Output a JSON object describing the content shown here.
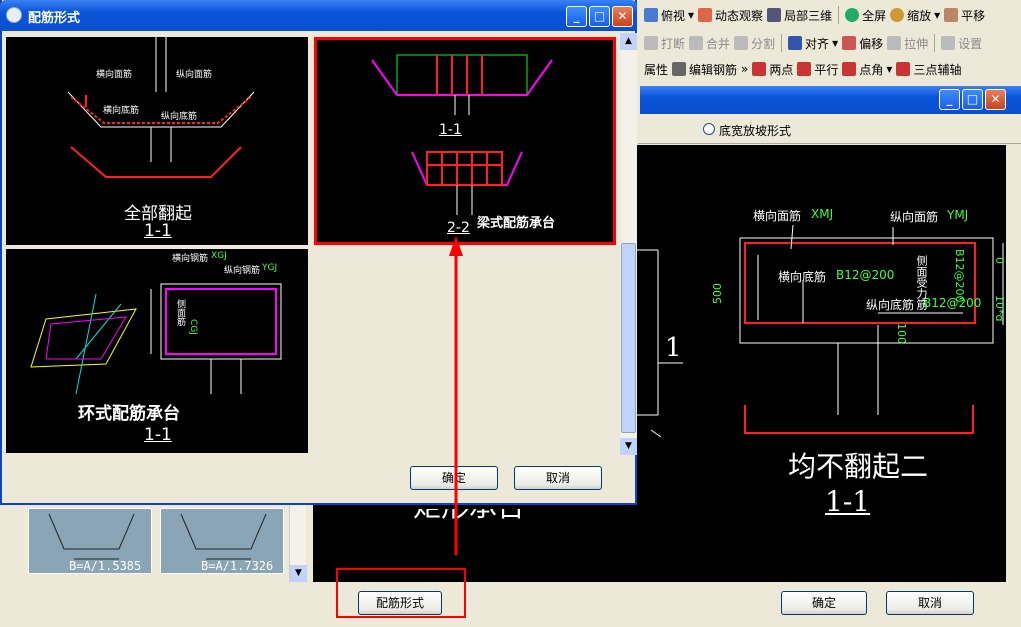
{
  "toolbar": {
    "row1": {
      "view": "俯视",
      "orbit": "动态观察",
      "local3d": "局部三维",
      "fullscreen": "全屏",
      "zoom": "缩放",
      "pan": "平移"
    },
    "row2": {
      "break": "打断",
      "merge": "合并",
      "split": "分割",
      "align": "对齐",
      "offset": "偏移",
      "stretch": "拉伸",
      "settings": "设置"
    },
    "row3": {
      "properties": "属性",
      "edit_rebar": "编辑钢筋",
      "two_point": "两点",
      "parallel": "平行",
      "point_angle": "点角",
      "three_point_axis": "三点辅轴"
    }
  },
  "bg_dialog": {
    "radio_label": "底宽放坡形式",
    "ok": "确定",
    "cancel": "取消",
    "rebar_button": "配筋形式",
    "preview": {
      "title": "均不翻起二",
      "section": "1-1",
      "xmj_label": "横向面筋",
      "xmj_code": "XMJ",
      "ymj_label": "纵向面筋",
      "ymj_code": "YMJ",
      "xdj_label": "横向底筋",
      "xdj_code": "B12@200",
      "ydj_label": "纵向底筋",
      "ydj_code": "B12@200",
      "side_label": "侧面受力筋",
      "side_code": "B12@200",
      "dim_500": "500",
      "dim_0": "0",
      "dim_10d": "10*d",
      "dim_100": "100",
      "left_label": "1"
    },
    "partial_title": "矩形承台",
    "thumbs": [
      {
        "formula": "B=A/1.5385"
      },
      {
        "formula": "B=A/1.7326"
      }
    ]
  },
  "dialog": {
    "title": "配筋形式",
    "ok": "确定",
    "cancel": "取消",
    "cells": [
      {
        "caption": "全部翻起",
        "section": "1-1",
        "labels": {
          "xmj": "横向面筋",
          "ymj": "纵向面筋",
          "xdj": "横向底筋",
          "ydj": "纵向底筋"
        }
      },
      {
        "caption": "梁式配筋承台",
        "section_top": "1-1",
        "section_bottom": "2-2"
      },
      {
        "caption": "环式配筋承台",
        "section": "1-1",
        "labels": {
          "xgj": "横向钢筋",
          "xgj_code": "XGJ",
          "ygj": "纵向钢筋",
          "ygj_code": "YGJ",
          "side": "侧面筋",
          "side_code": "CGJ"
        }
      }
    ]
  },
  "colors": {
    "accent": "#0a54d8",
    "highlight": "#ff0000",
    "cad_bg": "#000000"
  }
}
